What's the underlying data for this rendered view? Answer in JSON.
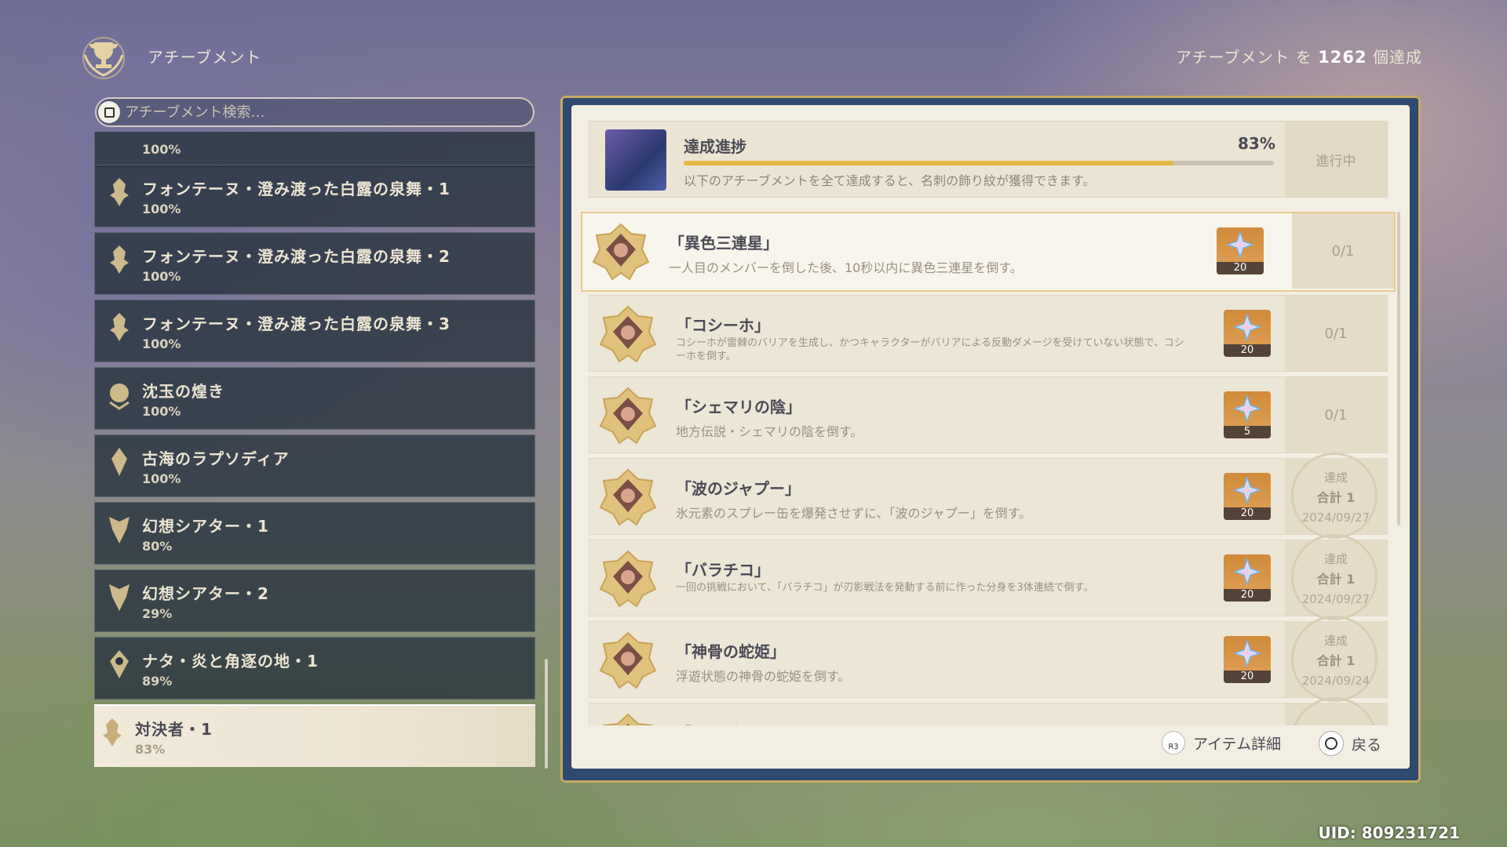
{
  "header": {
    "title": "アチーブメント",
    "count_prefix": "アチーブメント を ",
    "count": "1262",
    "count_suffix": " 個達成"
  },
  "search": {
    "placeholder": "アチーブメント検索…"
  },
  "categories": [
    {
      "name": "",
      "percent": "100%"
    },
    {
      "name": "フォンテーヌ・澄み渡った白露の泉舞・1",
      "percent": "100%"
    },
    {
      "name": "フォンテーヌ・澄み渡った白露の泉舞・2",
      "percent": "100%"
    },
    {
      "name": "フォンテーヌ・澄み渡った白露の泉舞・3",
      "percent": "100%"
    },
    {
      "name": "沈玉の煌き",
      "percent": "100%"
    },
    {
      "name": "古海のラプソディア",
      "percent": "100%"
    },
    {
      "name": "幻想シアター・1",
      "percent": "80%"
    },
    {
      "name": "幻想シアター・2",
      "percent": "29%"
    },
    {
      "name": "ナタ・炎と角逐の地・1",
      "percent": "89%"
    },
    {
      "name": "対決者・1",
      "percent": "83%"
    }
  ],
  "progress": {
    "title": "達成進捗",
    "percent": "83%",
    "percent_value": 0.83,
    "description": "以下のアチーブメントを全て達成すると、名刺の飾り紋が獲得できます。",
    "status": "進行中"
  },
  "achievements": [
    {
      "name": "「異色三連星」",
      "description": "一人目のメンバーを倒した後、10秒以内に異色三連星を倒す。",
      "reward": "20",
      "status": "0/1",
      "done": false
    },
    {
      "name": "「コシーホ」",
      "description": "コシーホが雷棘のバリアを生成し、かつキャラクターがバリアによる反動ダメージを受けていない状態で、コシーホを倒す。",
      "reward": "20",
      "status": "0/1",
      "done": false
    },
    {
      "name": "「シェマリの陰」",
      "description": "地方伝説・シェマリの陰を倒す。",
      "reward": "5",
      "status": "0/1",
      "done": false
    },
    {
      "name": "「波のジャプー」",
      "description": "氷元素のスプレー缶を爆発させずに、「波のジャプー」を倒す。",
      "reward": "20",
      "done": true,
      "label": "達成",
      "total": "合計 1",
      "date": "2024/09/27"
    },
    {
      "name": "「バラチコ」",
      "description": "一回の挑戦において、「バラチコ」が刃影戦法を発動する前に作った分身を3体連続で倒す。",
      "reward": "20",
      "done": true,
      "label": "達成",
      "total": "合計 1",
      "date": "2024/09/27"
    },
    {
      "name": "「神骨の蛇姫」",
      "description": "浮遊状態の神骨の蛇姫を倒す。",
      "reward": "20",
      "done": true,
      "label": "達成",
      "total": "合計 1",
      "date": "2024/09/24"
    },
    {
      "name": "「アンデッド」",
      "description": "",
      "reward": "",
      "done": true,
      "label": "",
      "total": "",
      "date": ""
    }
  ],
  "footer": {
    "detail_label": "アイテム詳細",
    "detail_key": "R3",
    "back_label": "戻る"
  },
  "uid": "UID: 809231721",
  "colors": {
    "accent_gold": "#e5b947",
    "panel_bg": "#f3eee2",
    "list_bg": "#28343f"
  }
}
